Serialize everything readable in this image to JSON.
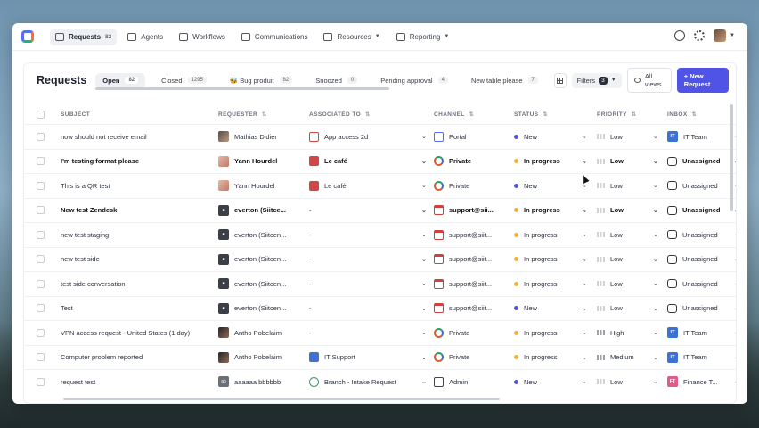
{
  "nav": {
    "items": [
      {
        "label": "Requests",
        "badge": "82",
        "active": true,
        "icon": "inbox-icon"
      },
      {
        "label": "Agents",
        "icon": "ai-icon"
      },
      {
        "label": "Workflows",
        "icon": "workflow-icon"
      },
      {
        "label": "Communications",
        "icon": "megaphone-icon"
      },
      {
        "label": "Resources",
        "icon": "layers-icon",
        "dropdown": true
      },
      {
        "label": "Reporting",
        "icon": "report-icon",
        "dropdown": true
      }
    ]
  },
  "page": {
    "title": "Requests",
    "tabs": [
      {
        "label": "Open",
        "count": "82",
        "active": true
      },
      {
        "label": "Closed",
        "count": "1295"
      },
      {
        "label": "Bug produit",
        "count": "82",
        "emoji": "🐝"
      },
      {
        "label": "Snoozed",
        "count": "0"
      },
      {
        "label": "Pending approval",
        "count": "4"
      },
      {
        "label": "New table please",
        "count": "7"
      }
    ],
    "filters_label": "Filters",
    "filters_count": "3",
    "all_views_label": "All views",
    "new_request_label": "+ New Request"
  },
  "table": {
    "columns": [
      "SUBJECT",
      "REQUESTER",
      "ASSOCIATED TO",
      "CHANNEL",
      "STATUS",
      "PRIORITY",
      "INBOX"
    ],
    "rows": [
      {
        "subject": "now should not receive email",
        "requester": "Mathias Didier",
        "req_av": "p1",
        "assoc": "App access 2d",
        "assoc_icon": "lock",
        "channel": "Portal",
        "ch_icon": "portal",
        "status": "New",
        "status_color": "#4f54e6",
        "priority": "Low",
        "inbox": "IT Team",
        "inbox_icon": "it",
        "bold": false
      },
      {
        "subject": "I'm testing format please",
        "requester": "Yann Hourdel",
        "req_av": "p2",
        "assoc": "Le café",
        "assoc_icon": "cafe",
        "channel": "Private",
        "ch_icon": "private",
        "status": "In progress",
        "status_color": "#f2b233",
        "priority": "Low",
        "inbox": "Unassigned",
        "inbox_icon": "inbox",
        "bold": true
      },
      {
        "subject": "This is a QR test",
        "requester": "Yann Hourdel",
        "req_av": "p2",
        "assoc": "Le café",
        "assoc_icon": "cafe",
        "channel": "Private",
        "ch_icon": "private",
        "status": "New",
        "status_color": "#4f54e6",
        "priority": "Low",
        "inbox": "Unassigned",
        "inbox_icon": "inbox",
        "bold": false
      },
      {
        "subject": "New test Zendesk",
        "requester": "everton (Siitce...",
        "req_av": "dark",
        "assoc": "-",
        "assoc_icon": "",
        "channel": "support@sii...",
        "ch_icon": "mail",
        "status": "In progress",
        "status_color": "#f2b233",
        "priority": "Low",
        "inbox": "Unassigned",
        "inbox_icon": "inbox",
        "bold": true
      },
      {
        "subject": "new test staging",
        "requester": "everton (Siitcen...",
        "req_av": "dark",
        "assoc": "-",
        "assoc_icon": "",
        "channel": "support@siit...",
        "ch_icon": "mail",
        "status": "In progress",
        "status_color": "#f2b233",
        "priority": "Low",
        "inbox": "Unassigned",
        "inbox_icon": "inbox",
        "bold": false
      },
      {
        "subject": "new test side",
        "requester": "everton (Siitcen...",
        "req_av": "dark",
        "assoc": "-",
        "assoc_icon": "",
        "channel": "support@siit...",
        "ch_icon": "mail",
        "status": "In progress",
        "status_color": "#f2b233",
        "priority": "Low",
        "inbox": "Unassigned",
        "inbox_icon": "inbox",
        "bold": false
      },
      {
        "subject": "test side conversation",
        "requester": "everton (Siitcen...",
        "req_av": "dark",
        "assoc": "-",
        "assoc_icon": "",
        "channel": "support@siit...",
        "ch_icon": "mail",
        "status": "In progress",
        "status_color": "#f2b233",
        "priority": "Low",
        "inbox": "Unassigned",
        "inbox_icon": "inbox",
        "bold": false
      },
      {
        "subject": "Test",
        "requester": "everton (Siitcen...",
        "req_av": "dark",
        "assoc": "-",
        "assoc_icon": "",
        "channel": "support@siit...",
        "ch_icon": "mail",
        "status": "New",
        "status_color": "#4f54e6",
        "priority": "Low",
        "inbox": "Unassigned",
        "inbox_icon": "inbox",
        "bold": false
      },
      {
        "subject": "VPN access request - United States (1 day)",
        "requester": "Antho Pobelaim",
        "req_av": "p3",
        "assoc": "-",
        "assoc_icon": "",
        "channel": "Private",
        "ch_icon": "private",
        "status": "In progress",
        "status_color": "#f2b233",
        "priority": "High",
        "inbox": "IT Team",
        "inbox_icon": "it",
        "bold": false
      },
      {
        "subject": "Computer problem reported",
        "requester": "Antho Pobelaim",
        "req_av": "p3",
        "assoc": "IT Support",
        "assoc_icon": "it",
        "channel": "Private",
        "ch_icon": "private",
        "status": "In progress",
        "status_color": "#f2b233",
        "priority": "Medium",
        "inbox": "IT Team",
        "inbox_icon": "it",
        "bold": false
      },
      {
        "subject": "request test",
        "requester": "aaaaaa bbbbbb",
        "req_av": "init",
        "assoc": "Branch - Intake Request",
        "assoc_icon": "branch",
        "channel": "Admin",
        "ch_icon": "admin",
        "status": "New",
        "status_color": "#4f54e6",
        "priority": "Low",
        "inbox": "Finance T...",
        "inbox_icon": "ft",
        "bold": false
      }
    ]
  },
  "badges": {
    "it": "IT",
    "ft": "FT",
    "ab": "ab"
  }
}
